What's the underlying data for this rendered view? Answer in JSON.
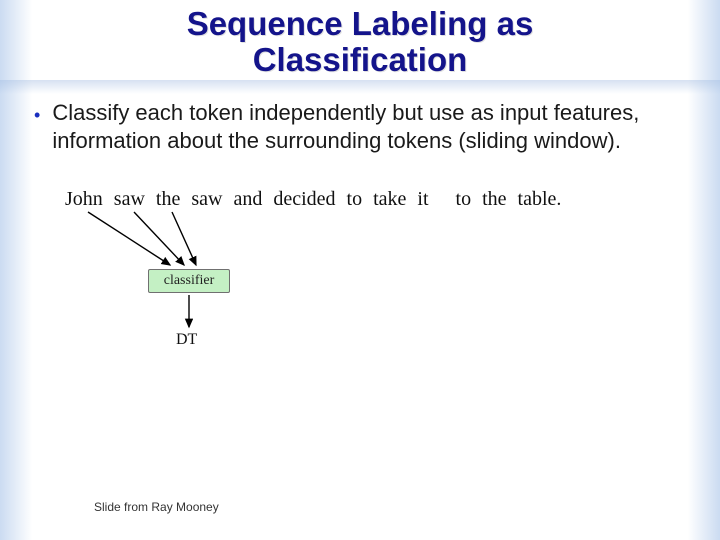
{
  "title_line1": "Sequence Labeling as",
  "title_line2": "Classification",
  "bullet": "Classify each token independently but use as input features, information about the surrounding tokens (sliding window).",
  "sentence_tokens": [
    "John",
    "saw",
    "the",
    "saw",
    "and",
    "decided",
    "to",
    "take",
    "it",
    "to",
    "the",
    "table."
  ],
  "classifier_label": "classifier",
  "output_tag": "DT",
  "credit": "Slide from Ray Mooney"
}
